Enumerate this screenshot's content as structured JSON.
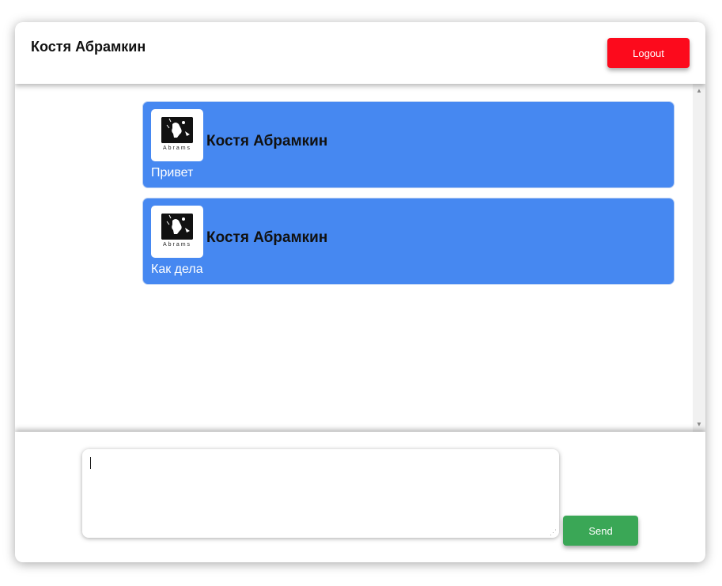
{
  "header": {
    "user_name": "Костя Абрамкин",
    "logout_label": "Logout"
  },
  "messages": [
    {
      "author": "Костя Абрамкин",
      "text": "Привет",
      "avatar_label": "Abrams",
      "avatar_icon": "abrams-logo-icon"
    },
    {
      "author": "Костя Абрамкин",
      "text": "Как дела",
      "avatar_label": "Abrams",
      "avatar_icon": "abrams-logo-icon"
    }
  ],
  "composer": {
    "input_value": "",
    "send_label": "Send"
  },
  "colors": {
    "message_bg": "#4688f1",
    "logout": "#fc0a1c",
    "send": "#3aa756"
  }
}
